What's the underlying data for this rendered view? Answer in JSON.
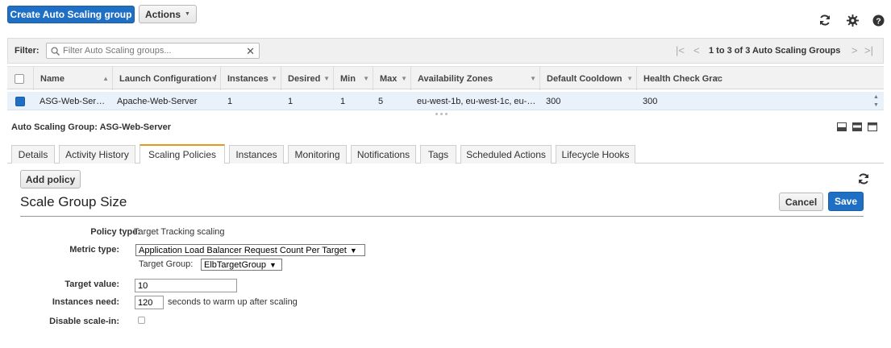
{
  "toolbar": {
    "create_label": "Create Auto Scaling group",
    "actions_label": "Actions",
    "actions_caret": "▼",
    "icons": [
      "refresh-icon",
      "gear-icon",
      "help-icon"
    ]
  },
  "filter": {
    "label": "Filter:",
    "placeholder": "Filter Auto Scaling groups...",
    "pagination": "1 to 3 of 3 Auto Scaling Groups"
  },
  "table": {
    "columns": [
      "Name",
      "Launch Configuration /",
      "Instances",
      "Desired",
      "Min",
      "Max",
      "Availability Zones",
      "Default Cooldown",
      "Health Check Grac"
    ],
    "rows": [
      {
        "name": "ASG-Web-Ser…",
        "launch_configuration": "Apache-Web-Server",
        "instances": "1",
        "desired": "1",
        "min": "1",
        "max": "5",
        "availability_zones": "eu-west-1b, eu-west-1c, eu-…",
        "default_cooldown": "300",
        "health_check_grace": "300"
      }
    ]
  },
  "details": {
    "title_prefix": "Auto Scaling Group:",
    "title_name": "ASG-Web-Server",
    "tabs": [
      "Details",
      "Activity History",
      "Scaling Policies",
      "Instances",
      "Monitoring",
      "Notifications",
      "Tags",
      "Scheduled Actions",
      "Lifecycle Hooks"
    ],
    "active_tab": "Scaling Policies"
  },
  "policy": {
    "add_policy_label": "Add policy",
    "section_title": "Scale Group Size",
    "cancel_label": "Cancel",
    "save_label": "Save",
    "policy_type_label": "Policy type:",
    "policy_type_value": "Target Tracking scaling",
    "metric_type_label": "Metric type:",
    "metric_type_value": "Application Load Balancer Request Count Per Target",
    "target_group_label": "Target Group:",
    "target_group_value": "ElbTargetGroup",
    "target_value_label": "Target value:",
    "target_value": "10",
    "instances_need_label": "Instances need:",
    "instances_need_value": "120",
    "instances_need_suffix": "seconds to warm up after scaling",
    "disable_scale_in_label": "Disable scale-in:",
    "disable_scale_in_checked": false
  },
  "colors": {
    "primary": "#1f6fc5",
    "active_tab_accent": "#e49a1c",
    "selected_row": "#e9f1fb"
  }
}
